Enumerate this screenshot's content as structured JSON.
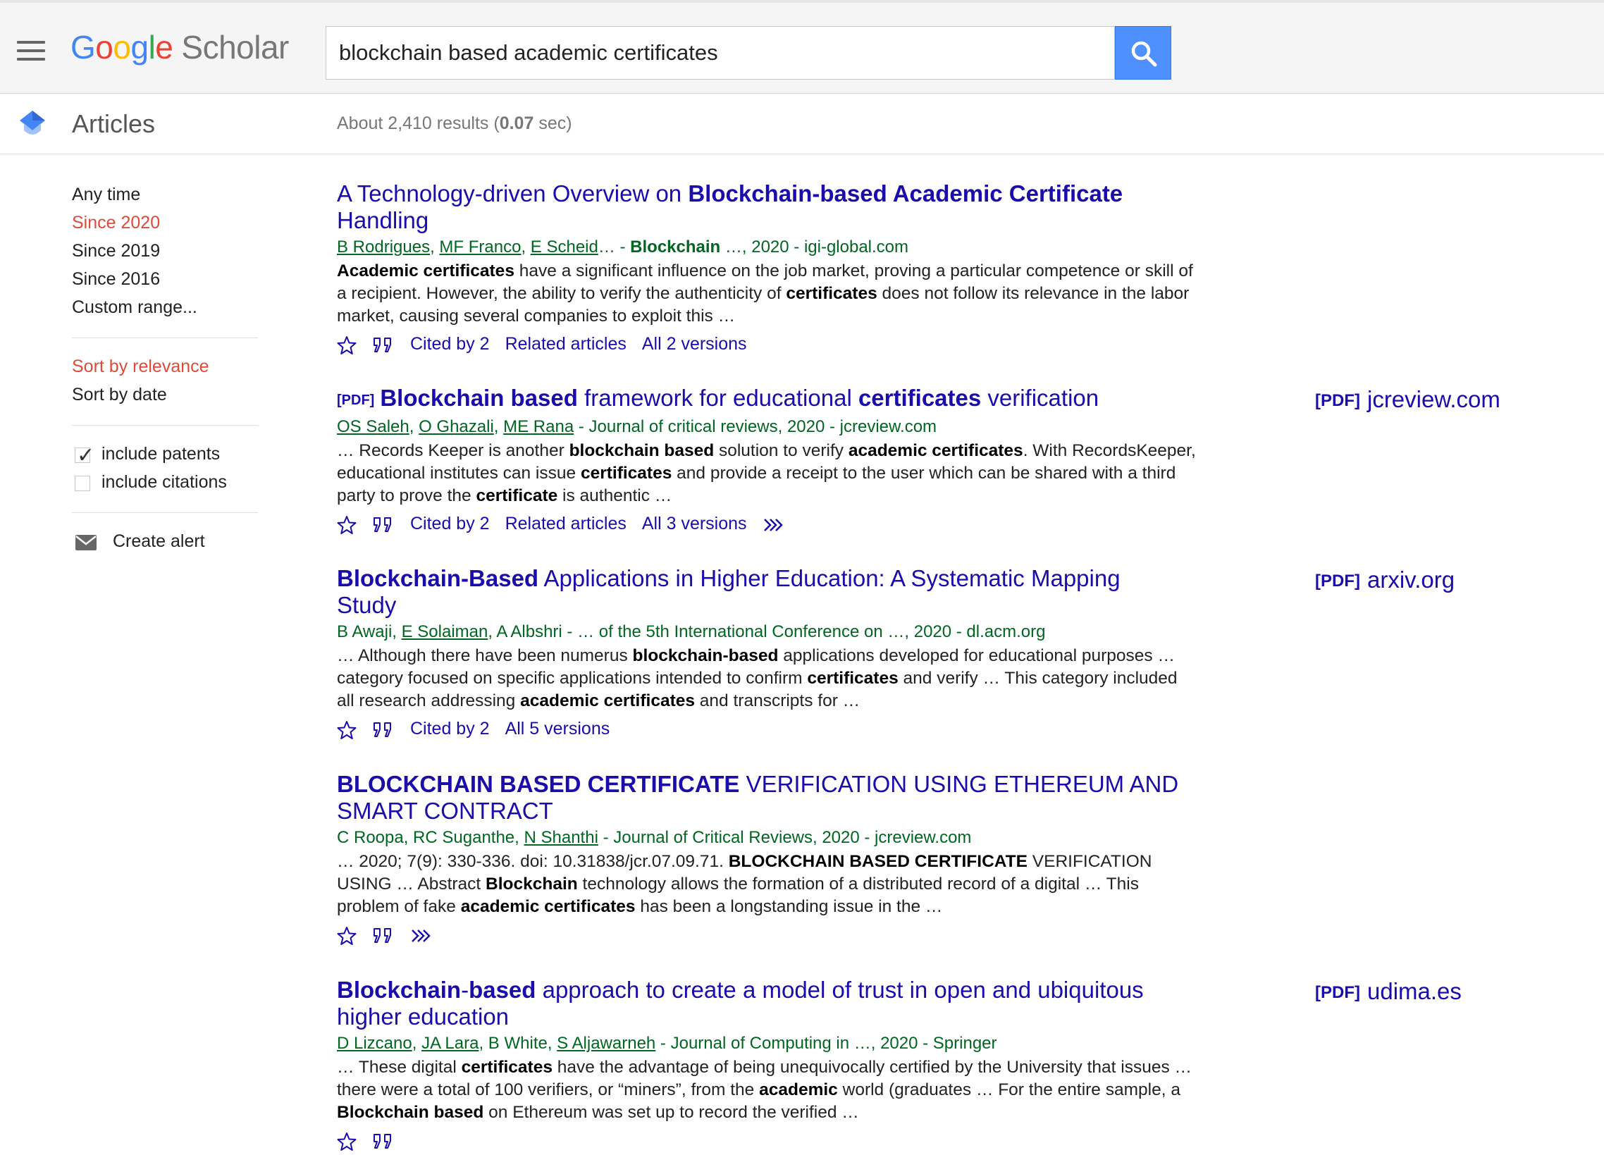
{
  "header": {
    "logo": {
      "g1": "G",
      "o1": "o",
      "o2": "o",
      "g2": "g",
      "l": "l",
      "e": "e",
      "product": "Scholar"
    },
    "search": {
      "value": "blockchain based academic certificates"
    }
  },
  "subheader": {
    "section": "Articles",
    "stats_prefix": "About 2,410 results (",
    "stats_time": "0.07",
    "stats_suffix": " sec)"
  },
  "sidebar": {
    "time_filters": [
      "Any time",
      "Since 2020",
      "Since 2019",
      "Since 2016",
      "Custom range..."
    ],
    "active_time_filter": "Since 2020",
    "sort": [
      "Sort by relevance",
      "Sort by date"
    ],
    "active_sort": "Sort by relevance",
    "include_patents": {
      "label": "include patents",
      "checked": true
    },
    "include_citations": {
      "label": "include citations",
      "checked": false
    },
    "create_alert": "Create alert"
  },
  "results": [
    {
      "title": [
        {
          "t": "A Technology-driven Overview on ",
          "b": false
        },
        {
          "t": "Blockchain-based Academic Certificate",
          "b": true
        },
        {
          "t": " Handling",
          "b": false
        }
      ],
      "pdf_prefix": false,
      "authors": [
        {
          "t": "B Rodrigues",
          "link": true
        },
        {
          "t": ", ",
          "link": false
        },
        {
          "t": "MF Franco",
          "link": true
        },
        {
          "t": ", ",
          "link": false
        },
        {
          "t": "E Scheid",
          "link": true
        },
        {
          "t": "… - ",
          "link": false
        }
      ],
      "venue": [
        {
          "t": "Blockchain",
          "b": true
        },
        {
          "t": " …, 2020 - igi-global.com",
          "b": false
        }
      ],
      "snippet": [
        {
          "t": "Academic certificates",
          "b": true
        },
        {
          "t": " have a significant influence on the job market, proving a particular competence or skill of a recipient. However, the ability to verify the authenticity of ",
          "b": false
        },
        {
          "t": "certificates",
          "b": true
        },
        {
          "t": " does not follow its relevance in the labor market, causing several companies to exploit this …",
          "b": false
        }
      ],
      "cited_by": "Cited by 2",
      "related": "Related articles",
      "versions": "All 2 versions",
      "more": false,
      "side_pdf": null
    },
    {
      "title": [
        {
          "t": "Blockchain based",
          "b": true
        },
        {
          "t": " framework for educational ",
          "b": false
        },
        {
          "t": "certificates",
          "b": true
        },
        {
          "t": " verification",
          "b": false
        }
      ],
      "pdf_prefix": true,
      "authors": [
        {
          "t": "OS Saleh",
          "link": true
        },
        {
          "t": ", ",
          "link": false
        },
        {
          "t": "O Ghazali",
          "link": true
        },
        {
          "t": ", ",
          "link": false
        },
        {
          "t": "ME Rana",
          "link": true
        },
        {
          "t": " - ",
          "link": false
        }
      ],
      "venue": [
        {
          "t": "Journal of critical reviews, 2020 - jcreview.com",
          "b": false
        }
      ],
      "snippet": [
        {
          "t": "… Records Keeper is another ",
          "b": false
        },
        {
          "t": "blockchain based",
          "b": true
        },
        {
          "t": " solution to verify ",
          "b": false
        },
        {
          "t": "academic certificates",
          "b": true
        },
        {
          "t": ". With RecordsKeeper, educational institutes can issue ",
          "b": false
        },
        {
          "t": "certificates",
          "b": true
        },
        {
          "t": " and provide a receipt to the user which can be shared with a third party to prove the ",
          "b": false
        },
        {
          "t": "certificate",
          "b": true
        },
        {
          "t": " is authentic …",
          "b": false
        }
      ],
      "cited_by": "Cited by 2",
      "related": "Related articles",
      "versions": "All 3 versions",
      "more": true,
      "side_pdf": "jcreview.com"
    },
    {
      "title": [
        {
          "t": "Blockchain-Based",
          "b": true
        },
        {
          "t": " Applications in Higher Education: A Systematic Mapping Study",
          "b": false
        }
      ],
      "pdf_prefix": false,
      "authors": [
        {
          "t": "B Awaji",
          "link": false
        },
        {
          "t": ", ",
          "link": false
        },
        {
          "t": "E Solaiman",
          "link": true
        },
        {
          "t": ", A Albshri - ",
          "link": false
        }
      ],
      "venue": [
        {
          "t": "… of the 5th International Conference on …, 2020 - dl.acm.org",
          "b": false
        }
      ],
      "snippet": [
        {
          "t": "… Although there have been numerus ",
          "b": false
        },
        {
          "t": "blockchain-based",
          "b": true
        },
        {
          "t": " applications developed for educational purposes … category focused on specific applications intended to confirm ",
          "b": false
        },
        {
          "t": "certificates",
          "b": true
        },
        {
          "t": " and verify … This category included all research addressing ",
          "b": false
        },
        {
          "t": "academic certificates",
          "b": true
        },
        {
          "t": " and transcripts for …",
          "b": false
        }
      ],
      "cited_by": "Cited by 2",
      "related": null,
      "versions": "All 5 versions",
      "more": false,
      "side_pdf": "arxiv.org"
    },
    {
      "title": [
        {
          "t": "BLOCKCHAIN BASED CERTIFICATE",
          "b": true
        },
        {
          "t": " VERIFICATION USING ETHEREUM AND SMART CONTRACT",
          "b": false
        }
      ],
      "pdf_prefix": false,
      "authors": [
        {
          "t": "C Roopa, RC Suganthe, ",
          "link": false
        },
        {
          "t": "N Shanthi",
          "link": true
        },
        {
          "t": " - ",
          "link": false
        }
      ],
      "venue": [
        {
          "t": "Journal of Critical Reviews, 2020 - jcreview.com",
          "b": false
        }
      ],
      "snippet": [
        {
          "t": "… 2020; 7(9): 330-336. doi: 10.31838/jcr.07.09.71. ",
          "b": false
        },
        {
          "t": "BLOCKCHAIN BASED CERTIFICATE",
          "b": true
        },
        {
          "t": " VERIFICATION USING … Abstract ",
          "b": false
        },
        {
          "t": "Blockchain",
          "b": true
        },
        {
          "t": " technology allows the formation of a distributed record of a digital … This problem of fake ",
          "b": false
        },
        {
          "t": "academic certificates",
          "b": true
        },
        {
          "t": " has been a longstanding issue in the …",
          "b": false
        }
      ],
      "cited_by": null,
      "related": null,
      "versions": null,
      "more": true,
      "side_pdf": null
    },
    {
      "title": [
        {
          "t": "Blockchain",
          "b": true
        },
        {
          "t": "-",
          "b": false
        },
        {
          "t": "based",
          "b": true
        },
        {
          "t": " approach to create a model of trust in open and ubiquitous higher education",
          "b": false
        }
      ],
      "pdf_prefix": false,
      "authors": [
        {
          "t": "D Lizcano",
          "link": true
        },
        {
          "t": ", ",
          "link": false
        },
        {
          "t": "JA Lara",
          "link": true
        },
        {
          "t": ", B White, ",
          "link": false
        },
        {
          "t": "S Aljawarneh",
          "link": true
        },
        {
          "t": " - ",
          "link": false
        }
      ],
      "venue": [
        {
          "t": "Journal of Computing in …, 2020 - Springer",
          "b": false
        }
      ],
      "snippet": [
        {
          "t": "… These digital ",
          "b": false
        },
        {
          "t": "certificates",
          "b": true
        },
        {
          "t": " have the advantage of being unequivocally certified by the University that issues … there were a total of 100 verifiers, or “miners”, from the ",
          "b": false
        },
        {
          "t": "academic",
          "b": true
        },
        {
          "t": " world (graduates … For the entire sample, a ",
          "b": false
        },
        {
          "t": "Blockchain based",
          "b": true
        },
        {
          "t": " on Ethereum was set up to record the verified …",
          "b": false
        }
      ],
      "cited_by": null,
      "related": null,
      "versions": null,
      "more": false,
      "side_pdf": "udima.es"
    }
  ],
  "labels": {
    "pdf": "[PDF]"
  },
  "colors": {
    "link": "#1a0dab",
    "meta": "#006621",
    "active": "#dd4b39",
    "search_button": "#4d90fe"
  }
}
